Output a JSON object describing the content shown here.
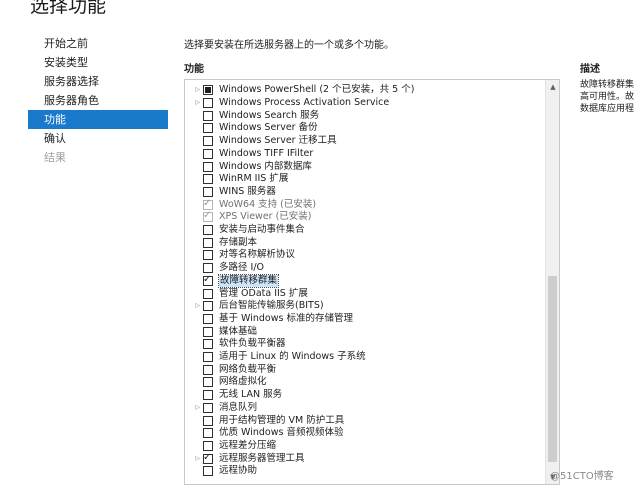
{
  "page": {
    "title": "选择功能"
  },
  "nav": [
    {
      "label": "开始之前",
      "state": "normal"
    },
    {
      "label": "安装类型",
      "state": "normal"
    },
    {
      "label": "服务器选择",
      "state": "normal"
    },
    {
      "label": "服务器角色",
      "state": "normal"
    },
    {
      "label": "功能",
      "state": "active"
    },
    {
      "label": "确认",
      "state": "normal"
    },
    {
      "label": "结果",
      "state": "disabled"
    }
  ],
  "content": {
    "instruction": "选择要安装在所选服务器上的一个或多个功能。",
    "features_header": "功能",
    "description_header": "描述",
    "description_lines": [
      "故障转移群集",
      "高可用性。故",
      "数据库应用程"
    ]
  },
  "features": [
    {
      "label": "Windows PowerShell (2 个已安装，共 5 个)",
      "expandable": true,
      "state": "partial"
    },
    {
      "label": "Windows Process Activation Service",
      "expandable": true,
      "state": "unchecked"
    },
    {
      "label": "Windows Search 服务",
      "expandable": false,
      "state": "unchecked"
    },
    {
      "label": "Windows Server 备份",
      "expandable": false,
      "state": "unchecked"
    },
    {
      "label": "Windows Server 迁移工具",
      "expandable": false,
      "state": "unchecked"
    },
    {
      "label": "Windows TIFF IFilter",
      "expandable": false,
      "state": "unchecked"
    },
    {
      "label": "Windows 内部数据库",
      "expandable": false,
      "state": "unchecked"
    },
    {
      "label": "WinRM IIS 扩展",
      "expandable": false,
      "state": "unchecked"
    },
    {
      "label": "WINS 服务器",
      "expandable": false,
      "state": "unchecked"
    },
    {
      "label": "WoW64 支持 (已安装)",
      "expandable": false,
      "state": "installed"
    },
    {
      "label": "XPS Viewer (已安装)",
      "expandable": false,
      "state": "installed"
    },
    {
      "label": "安装与启动事件集合",
      "expandable": false,
      "state": "unchecked"
    },
    {
      "label": "存储副本",
      "expandable": false,
      "state": "unchecked"
    },
    {
      "label": "对等名称解析协议",
      "expandable": false,
      "state": "unchecked"
    },
    {
      "label": "多路径 I/O",
      "expandable": false,
      "state": "unchecked"
    },
    {
      "label": "故障转移群集",
      "expandable": false,
      "state": "checked",
      "selected": true
    },
    {
      "label": "管理 OData IIS 扩展",
      "expandable": false,
      "state": "unchecked"
    },
    {
      "label": "后台智能传输服务(BITS)",
      "expandable": true,
      "state": "unchecked"
    },
    {
      "label": "基于 Windows 标准的存储管理",
      "expandable": false,
      "state": "unchecked"
    },
    {
      "label": "媒体基础",
      "expandable": false,
      "state": "unchecked"
    },
    {
      "label": "软件负载平衡器",
      "expandable": false,
      "state": "unchecked"
    },
    {
      "label": "适用于 Linux 的 Windows 子系统",
      "expandable": false,
      "state": "unchecked"
    },
    {
      "label": "网络负载平衡",
      "expandable": false,
      "state": "unchecked"
    },
    {
      "label": "网络虚拟化",
      "expandable": false,
      "state": "unchecked"
    },
    {
      "label": "无线 LAN 服务",
      "expandable": false,
      "state": "unchecked"
    },
    {
      "label": "消息队列",
      "expandable": true,
      "state": "unchecked"
    },
    {
      "label": "用于结构管理的 VM 防护工具",
      "expandable": false,
      "state": "unchecked"
    },
    {
      "label": "优质 Windows 音频视频体验",
      "expandable": false,
      "state": "unchecked"
    },
    {
      "label": "远程差分压缩",
      "expandable": false,
      "state": "unchecked"
    },
    {
      "label": "远程服务器管理工具",
      "expandable": true,
      "state": "checked"
    },
    {
      "label": "远程协助",
      "expandable": false,
      "state": "unchecked"
    }
  ],
  "icons": {
    "expander": "▷",
    "checkmark": "✓",
    "scroll_up": "▲",
    "scroll_down": "▼"
  },
  "watermark": "@51CTO博客"
}
